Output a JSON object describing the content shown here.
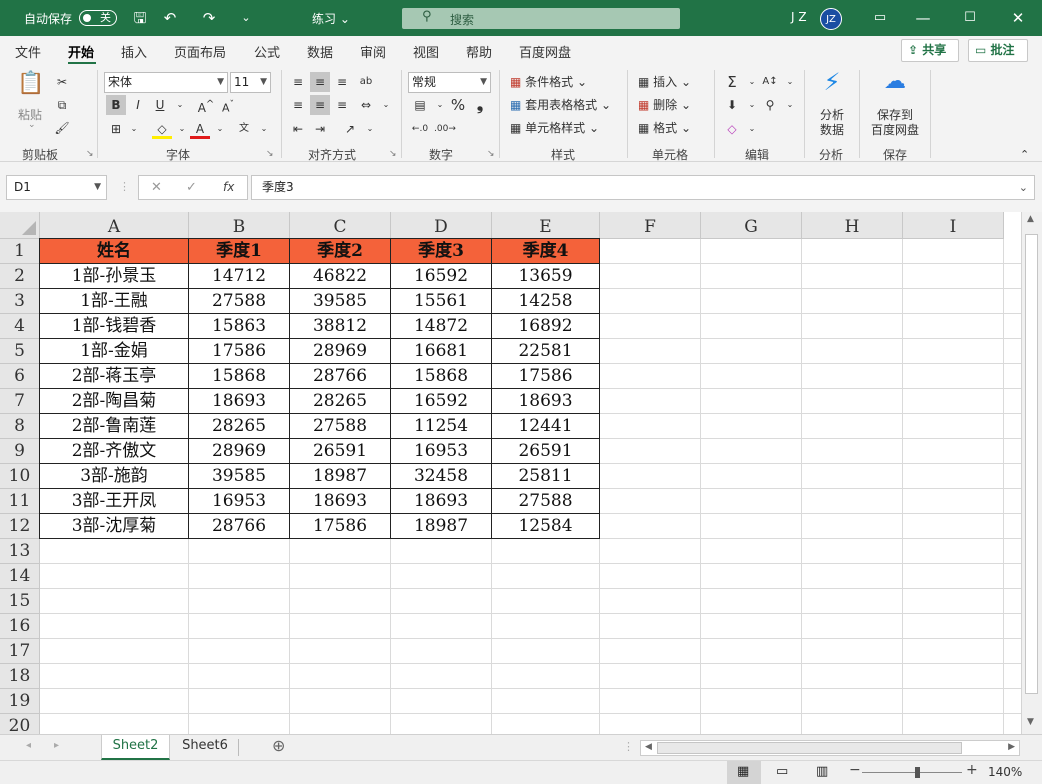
{
  "titlebar": {
    "autosave_label": "自动保存",
    "autosave_state": "关",
    "filename": "练习 ⌄",
    "search_placeholder": "搜索",
    "user_initials": "J Z",
    "avatar_text": "JZ"
  },
  "menu": {
    "tabs": [
      "文件",
      "开始",
      "插入",
      "页面布局",
      "公式",
      "数据",
      "审阅",
      "视图",
      "帮助",
      "百度网盘"
    ],
    "active_tab": "开始",
    "share_label": "共享",
    "comment_label": "批注"
  },
  "ribbon": {
    "clipboard": {
      "paste": "粘贴",
      "group": "剪贴板"
    },
    "font": {
      "name": "宋体",
      "size": "11",
      "group": "字体",
      "bold": "B",
      "italic": "I",
      "underline": "U"
    },
    "alignment": {
      "group": "对齐方式"
    },
    "number": {
      "format": "常规",
      "group": "数字",
      "percent": "%",
      "comma": "❟"
    },
    "styles": {
      "conditional": "条件格式 ⌄",
      "table": "套用表格格式 ⌄",
      "cell_styles": "单元格样式 ⌄",
      "group": "样式"
    },
    "cells": {
      "insert": "插入 ⌄",
      "delete": "删除 ⌄",
      "format": "格式 ⌄",
      "group": "单元格"
    },
    "editing": {
      "group": "编辑"
    },
    "analysis": {
      "label1": "分析",
      "label2": "数据",
      "group": "分析"
    },
    "save": {
      "label1": "保存到",
      "label2": "百度网盘",
      "group": "保存"
    }
  },
  "formula_bar": {
    "name_box": "D1",
    "formula": "季度3"
  },
  "grid": {
    "columns": [
      "A",
      "B",
      "C",
      "D",
      "E",
      "F",
      "G",
      "H",
      "I"
    ],
    "rows": [
      "1",
      "2",
      "3",
      "4",
      "5",
      "6",
      "7",
      "8",
      "9",
      "10",
      "11",
      "12",
      "13",
      "14",
      "15",
      "16",
      "17",
      "18",
      "19",
      "20"
    ],
    "header_row": [
      "姓名",
      "季度1",
      "季度2",
      "季度3",
      "季度4"
    ],
    "data": [
      [
        "1部-孙景玉",
        "14712",
        "46822",
        "16592",
        "13659"
      ],
      [
        "1部-王融",
        "27588",
        "39585",
        "15561",
        "14258"
      ],
      [
        "1部-钱碧香",
        "15863",
        "38812",
        "14872",
        "16892"
      ],
      [
        "1部-金娟",
        "17586",
        "28969",
        "16681",
        "22581"
      ],
      [
        "2部-蒋玉亭",
        "15868",
        "28766",
        "15868",
        "17586"
      ],
      [
        "2部-陶昌菊",
        "18693",
        "28265",
        "16592",
        "18693"
      ],
      [
        "2部-鲁南莲",
        "28265",
        "27588",
        "11254",
        "12441"
      ],
      [
        "2部-齐傲文",
        "28969",
        "26591",
        "16953",
        "26591"
      ],
      [
        "3部-施韵",
        "39585",
        "18987",
        "32458",
        "25811"
      ],
      [
        "3部-王开凤",
        "16953",
        "18693",
        "18693",
        "27588"
      ],
      [
        "3部-沈厚菊",
        "28766",
        "17586",
        "18987",
        "12584"
      ]
    ],
    "header_color": "#f4623a"
  },
  "sheets": [
    "Sheet2",
    "Sheet6"
  ],
  "active_sheet": "Sheet2",
  "status": {
    "zoom": "140%"
  },
  "colors": {
    "accent": "#217346"
  }
}
